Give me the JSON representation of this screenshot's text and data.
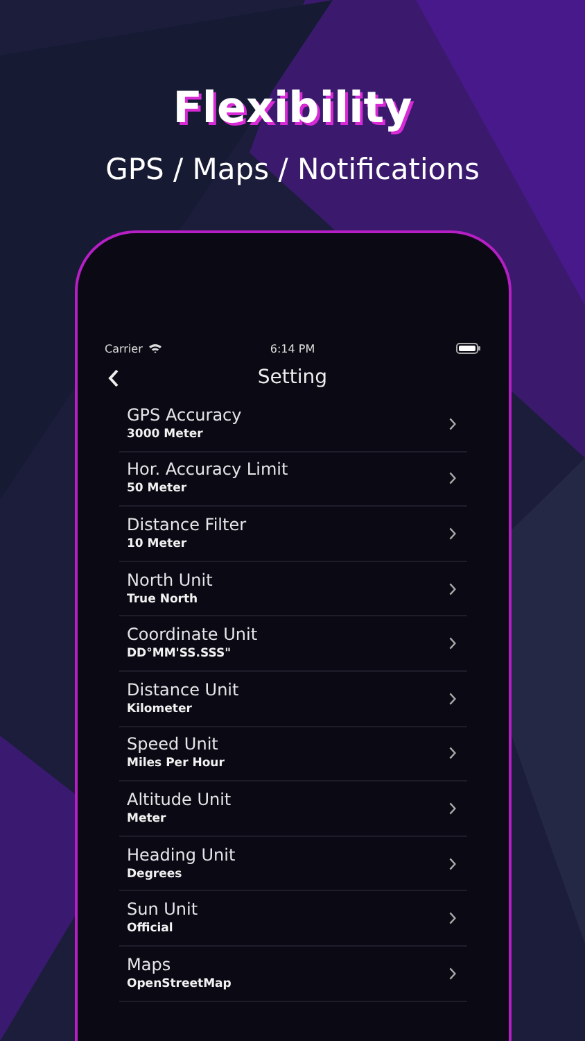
{
  "headline": "Flexibility",
  "subheadline": "GPS / Maps / Notifications",
  "status_bar": {
    "carrier": "Carrier",
    "time": "6:14 PM"
  },
  "nav": {
    "title": "Setting"
  },
  "settings": [
    {
      "title": "GPS Accuracy",
      "value": "3000 Meter"
    },
    {
      "title": "Hor. Accuracy Limit",
      "value": "50 Meter"
    },
    {
      "title": "Distance Filter",
      "value": "10 Meter"
    },
    {
      "title": "North Unit",
      "value": "True North"
    },
    {
      "title": "Coordinate Unit",
      "value": "DD°MM'SS.SSS\""
    },
    {
      "title": "Distance Unit",
      "value": "Kilometer"
    },
    {
      "title": "Speed Unit",
      "value": "Miles Per Hour"
    },
    {
      "title": "Altitude Unit",
      "value": "Meter"
    },
    {
      "title": "Heading Unit",
      "value": "Degrees"
    },
    {
      "title": "Sun Unit",
      "value": "Official"
    },
    {
      "title": "Maps",
      "value": "OpenStreetMap"
    }
  ]
}
